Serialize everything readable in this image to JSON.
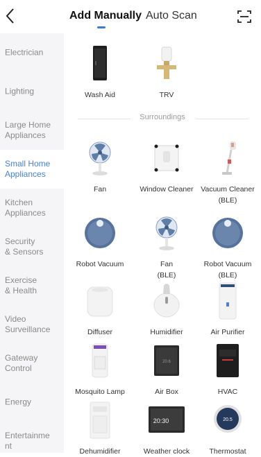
{
  "header": {
    "back_icon": "chevron-left-icon",
    "tabs": [
      {
        "label": "Add Manually",
        "active": true
      },
      {
        "label": "Auto Scan",
        "active": false
      }
    ],
    "scan_icon": "scan-frame-icon",
    "accent_color": "#3a7bd5"
  },
  "sidebar": {
    "items": [
      {
        "label": "Electrician",
        "active": false
      },
      {
        "label": "Lighting",
        "active": false
      },
      {
        "label": "Large Home\nAppliances",
        "active": false
      },
      {
        "label": "Small Home\nAppliances",
        "active": true
      },
      {
        "label": "Kitchen\nAppliances",
        "active": false
      },
      {
        "label": "Security\n& Sensors",
        "active": false
      },
      {
        "label": "Exercise\n& Health",
        "active": false
      },
      {
        "label": "Video\nSurveillance",
        "active": false
      },
      {
        "label": "Gateway\nControl",
        "active": false
      },
      {
        "label": "Energy",
        "active": false
      },
      {
        "label": "Entertainme\nnt",
        "active": false
      }
    ],
    "active_color": "#4a7fd8"
  },
  "main": {
    "top_devices": [
      {
        "label": "Wash Aid",
        "icon": "wash-aid-icon"
      },
      {
        "label": "TRV",
        "icon": "trv-valve-icon"
      }
    ],
    "section_title": "Surroundings",
    "devices": [
      {
        "label": "Fan",
        "icon": "fan-icon"
      },
      {
        "label": "Window Cleaner",
        "icon": "window-cleaner-icon"
      },
      {
        "label": "Vacuum Cleaner\n(BLE)",
        "icon": "vacuum-cleaner-icon"
      },
      {
        "label": "Robot Vacuum",
        "icon": "robot-vacuum-icon"
      },
      {
        "label": "Fan\n(BLE)",
        "icon": "fan-icon"
      },
      {
        "label": "Robot Vacuum\n(BLE)",
        "icon": "robot-vacuum-icon"
      },
      {
        "label": "Diffuser",
        "icon": "diffuser-icon"
      },
      {
        "label": "Humidifier",
        "icon": "humidifier-icon"
      },
      {
        "label": "Air Purifier",
        "icon": "air-purifier-icon"
      },
      {
        "label": "Mosquito Lamp",
        "icon": "mosquito-lamp-icon"
      },
      {
        "label": "Air Box",
        "icon": "air-box-icon"
      },
      {
        "label": "HVAC",
        "icon": "hvac-icon"
      },
      {
        "label": "Dehumidifier",
        "icon": "dehumidifier-icon"
      },
      {
        "label": "Weather clock",
        "icon": "weather-clock-icon"
      },
      {
        "label": "Thermostat",
        "icon": "thermostat-icon"
      }
    ],
    "screen_texts": {
      "weather_clock_time": "20:30",
      "thermostat_value": "20.5",
      "air_box_value": "20.6"
    }
  }
}
